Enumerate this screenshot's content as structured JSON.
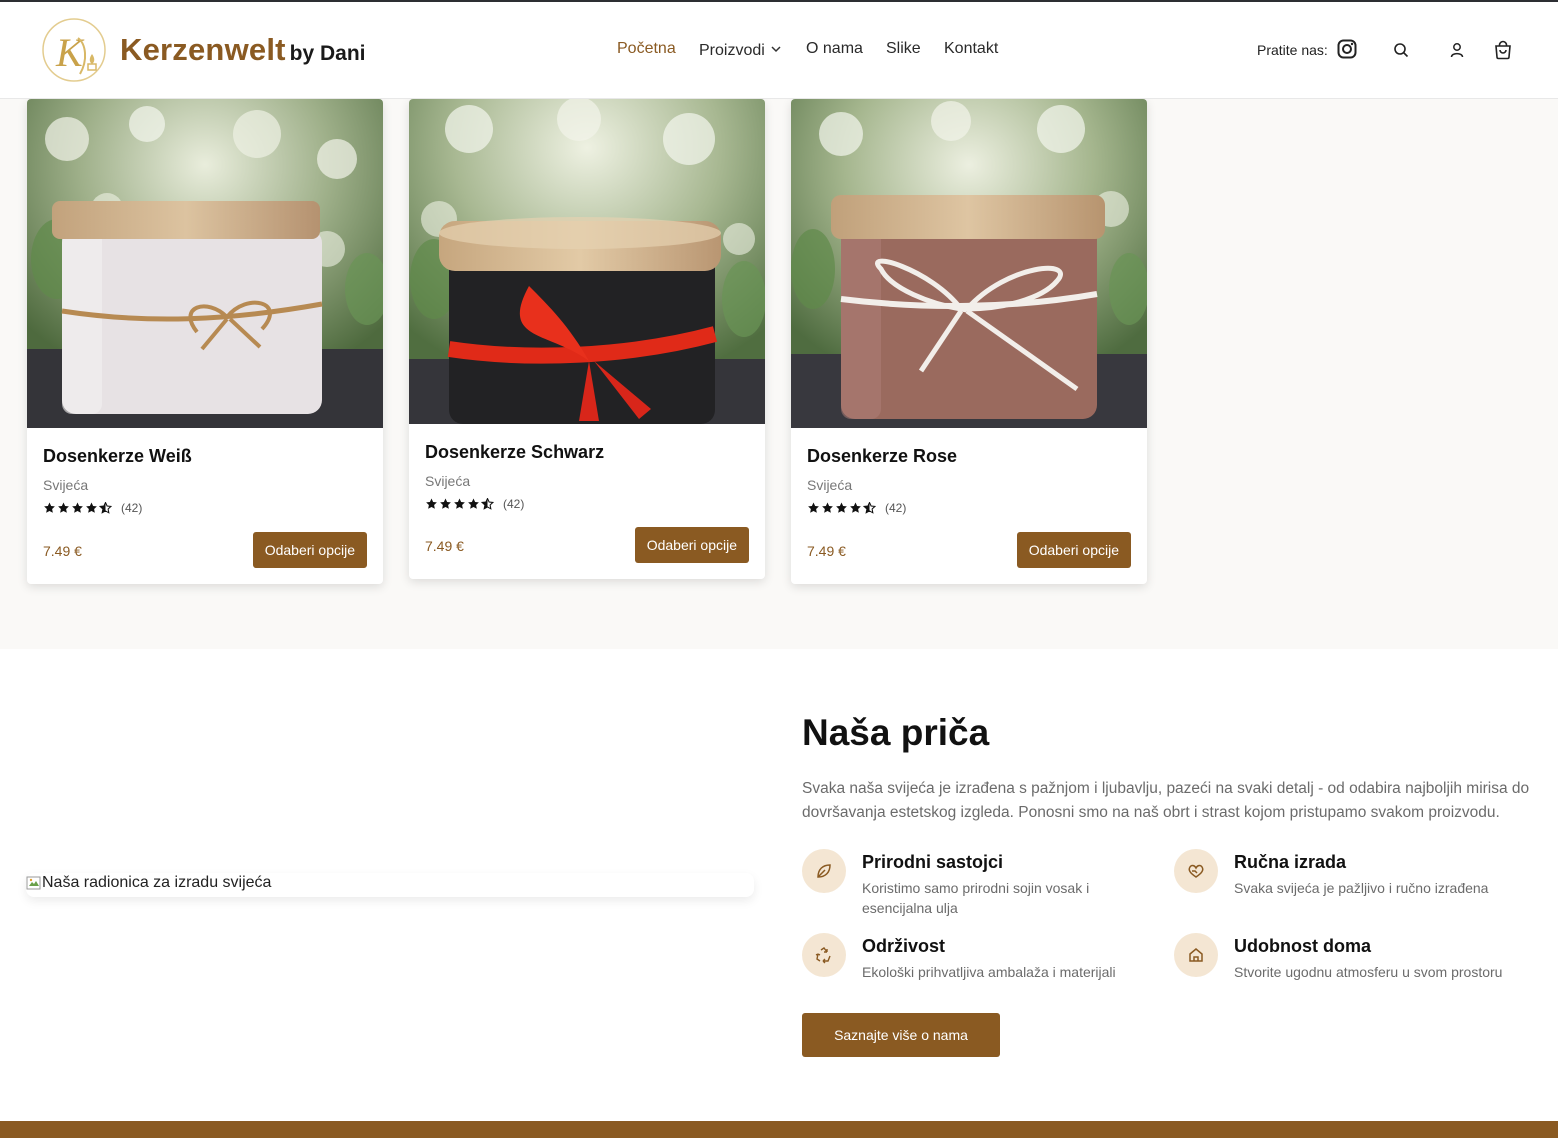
{
  "brand": {
    "name": "Kerzenwelt",
    "suffix": "by Dani"
  },
  "nav": {
    "items": [
      {
        "label": "Početna",
        "active": true
      },
      {
        "label": "Proizvodi",
        "dropdown": true
      },
      {
        "label": "O nama"
      },
      {
        "label": "Slike"
      },
      {
        "label": "Kontakt"
      }
    ]
  },
  "header": {
    "follow_label": "Pratite nas:",
    "icons": [
      "instagram-icon",
      "search-icon",
      "account-icon",
      "cart-icon"
    ]
  },
  "products": [
    {
      "title": "Dosenkerze Weiß",
      "category": "Svijeća",
      "rating": 4.5,
      "reviews": "(42)",
      "price": "7.49 €",
      "button": "Odaberi opcije",
      "jar_color": "#e7e2e4",
      "ribbon": "twine"
    },
    {
      "title": "Dosenkerze Schwarz",
      "category": "Svijeća",
      "rating": 4.5,
      "reviews": "(42)",
      "price": "7.49 €",
      "button": "Odaberi opcije",
      "jar_color": "#222224",
      "ribbon": "red"
    },
    {
      "title": "Dosenkerze Rose",
      "category": "Svijeća",
      "rating": 4.5,
      "reviews": "(42)",
      "price": "7.49 €",
      "button": "Odaberi opcije",
      "jar_color": "#9a6a5e",
      "ribbon": "white"
    }
  ],
  "story": {
    "image_alt": "Naša radionica za izradu svijeća",
    "title": "Naša priča",
    "text": "Svaka naša svijeća je izrađena s pažnjom i ljubavlju, pazeći na svaki detalj - od odabira najboljih mirisa do dovršavanja estetskog izgleda. Ponosni smo na naš obrt i strast kojom pristupamo svakom proizvodu.",
    "features": [
      {
        "icon": "leaf-icon",
        "title": "Prirodni sastojci",
        "desc": "Koristimo samo prirodni sojin vosak i esencijalna ulja"
      },
      {
        "icon": "hand-heart-icon",
        "title": "Ručna izrada",
        "desc": "Svaka svijeća je pažljivo i ručno izrađena"
      },
      {
        "icon": "recycle-icon",
        "title": "Održivost",
        "desc": "Ekološki prihvatljiva ambalaža i materijali"
      },
      {
        "icon": "home-icon",
        "title": "Udobnost doma",
        "desc": "Stvorite ugodnu atmosferu u svom prostoru"
      }
    ],
    "button": "Saznajte više o nama"
  },
  "colors": {
    "accent": "#8a5a22",
    "icon_bg": "#f4e6d3",
    "section_bg": "#faf9f7"
  }
}
